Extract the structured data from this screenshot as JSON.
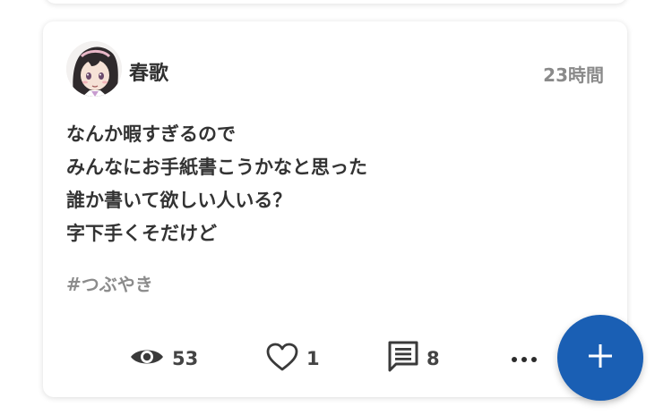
{
  "post": {
    "username": "春歌",
    "time": "23時間",
    "lines": [
      "なんか暇すぎるので",
      "みんなにお手紙書こうかなと思った",
      "誰か書いて欲しい人いる？",
      "字下手くそだけど"
    ],
    "tag": "#つぶやき"
  },
  "actions": {
    "views": "53",
    "likes": "1",
    "comments": "8"
  },
  "icons": [
    "eye-icon",
    "heart-icon",
    "comment-icon",
    "more-icon",
    "plus-icon"
  ],
  "colors": {
    "fab": "#1a5fb4",
    "accent": "#1a5fb4"
  }
}
